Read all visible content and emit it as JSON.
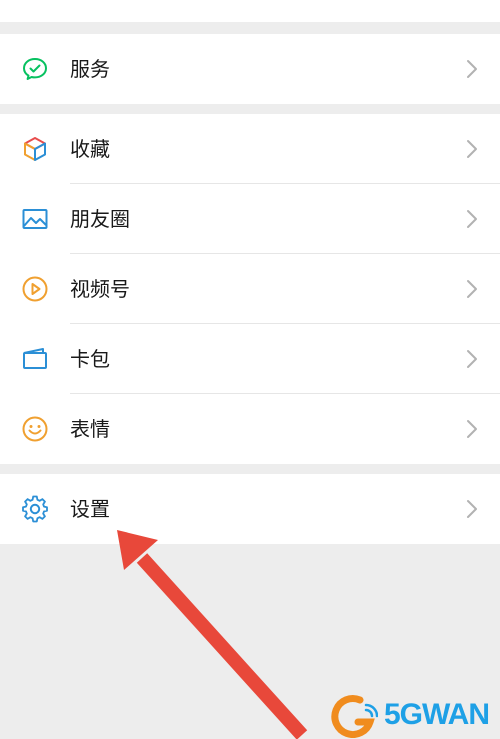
{
  "menu": {
    "services": "服务",
    "favorites": "收藏",
    "moments": "朋友圈",
    "channels": "视频号",
    "cards": "卡包",
    "stickers": "表情",
    "settings": "设置"
  },
  "watermark": {
    "text": "5GWAN"
  },
  "colors": {
    "services_icon": "#07c160",
    "moments_icon": "#2b8fd6",
    "channels_icon": "#f0a030",
    "cards_icon": "#2b8fd6",
    "stickers_icon": "#f0a030",
    "settings_icon": "#2b8fd6",
    "annotation_arrow": "#e8483a"
  }
}
